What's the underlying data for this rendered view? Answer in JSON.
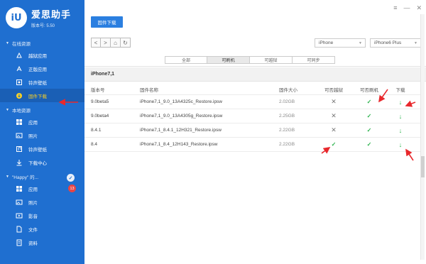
{
  "brand": {
    "logo": "iU",
    "name": "爱思助手",
    "version": "版本号: 5.50"
  },
  "window_controls": [
    "≡",
    "—",
    "✕"
  ],
  "sidebar": {
    "online_section": "在线资源",
    "online_items": [
      {
        "label": "越狱应用",
        "icon": "jailbreak-app-icon"
      },
      {
        "label": "正版应用",
        "icon": "app-store-icon"
      },
      {
        "label": "铃声壁纸",
        "icon": "ringtone-icon"
      },
      {
        "label": "固件下载",
        "icon": "firmware-icon",
        "active": true
      }
    ],
    "local_section": "本地资源",
    "local_items": [
      {
        "label": "应用",
        "icon": "apps-icon"
      },
      {
        "label": "照片",
        "icon": "photo-icon"
      },
      {
        "label": "铃声壁纸",
        "icon": "music-icon"
      },
      {
        "label": "下载中心",
        "icon": "download-center-icon"
      }
    ],
    "device_section": "\"Happy\" 的...",
    "device_items": [
      {
        "label": "应用",
        "icon": "apps-icon",
        "badge": "13"
      },
      {
        "label": "照片",
        "icon": "photo-icon"
      },
      {
        "label": "影音",
        "icon": "media-icon"
      },
      {
        "label": "文件",
        "icon": "file-icon"
      },
      {
        "label": "资料",
        "icon": "data-icon"
      }
    ]
  },
  "toolbar": {
    "firmware_button": "固件下载",
    "nav": [
      "<",
      ">",
      "⌂",
      "↻"
    ],
    "device_select": "iPhone",
    "model_select": "iPhone6 Plus"
  },
  "filters": [
    "全部",
    "可刷机",
    "可越狱",
    "可同步"
  ],
  "active_filter": 1,
  "model_title": "iPhone7,1",
  "table": {
    "headers": [
      "版本号",
      "固件名称",
      "固件大小",
      "可否越狱",
      "可否刷机",
      "下载"
    ],
    "rows": [
      {
        "version": "9.0beta5",
        "name": "iPhone7,1_9.0_13A4325c_Restore.ipsw",
        "size": "2.02GB",
        "jailbreak": false,
        "flash": true,
        "download": "↓"
      },
      {
        "version": "9.0beta4",
        "name": "iPhone7,1_9.0_13A4305g_Restore.ipsw",
        "size": "2.25GB",
        "jailbreak": false,
        "flash": true,
        "download": "↓"
      },
      {
        "version": "8.4.1",
        "name": "iPhone7,1_8.4.1_12H321_Restore.ipsw",
        "size": "2.22GB",
        "jailbreak": false,
        "flash": true,
        "download": "↓"
      },
      {
        "version": "8.4",
        "name": "iPhone7,1_8.4_12H143_Restore.ipsw",
        "size": "2.22GB",
        "jailbreak": true,
        "flash": true,
        "download": "↓"
      }
    ],
    "yes_mark": "✓",
    "no_mark": "✕"
  },
  "colors": {
    "sidebar": "#1f6fd0",
    "accent": "#2b7fe0",
    "annotation": "#e8282c",
    "ok": "#2bb24c"
  }
}
